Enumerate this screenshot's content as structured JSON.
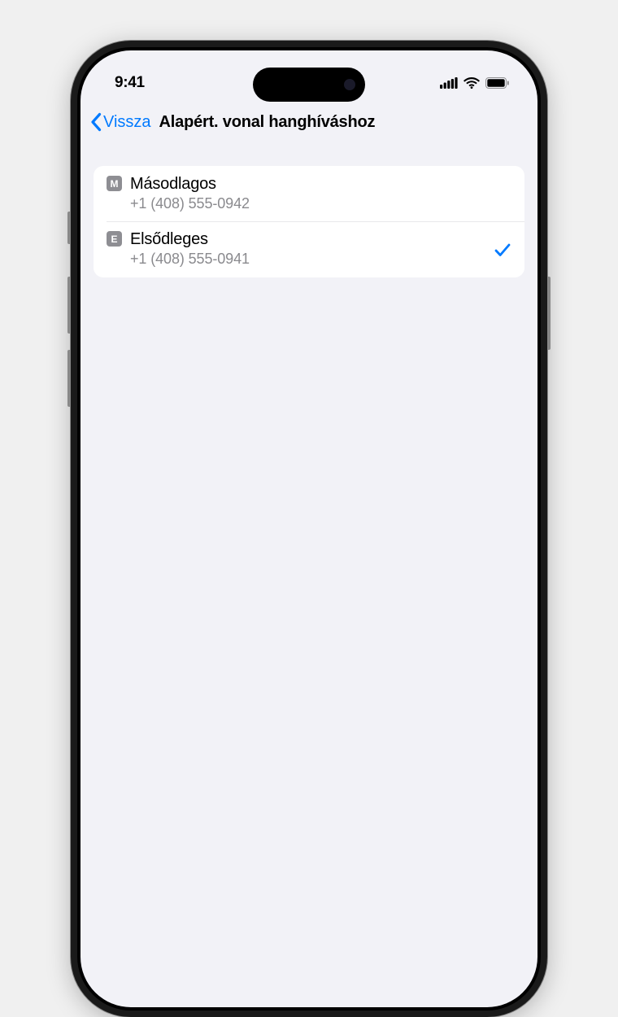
{
  "statusBar": {
    "time": "9:41"
  },
  "nav": {
    "backLabel": "Vissza",
    "title": "Alapért. vonal hanghíváshoz"
  },
  "lines": [
    {
      "badge": "M",
      "label": "Másodlagos",
      "number": "+1 (408) 555-0942",
      "selected": false
    },
    {
      "badge": "E",
      "label": "Elsődleges",
      "number": "+1 (408) 555-0941",
      "selected": true
    }
  ]
}
